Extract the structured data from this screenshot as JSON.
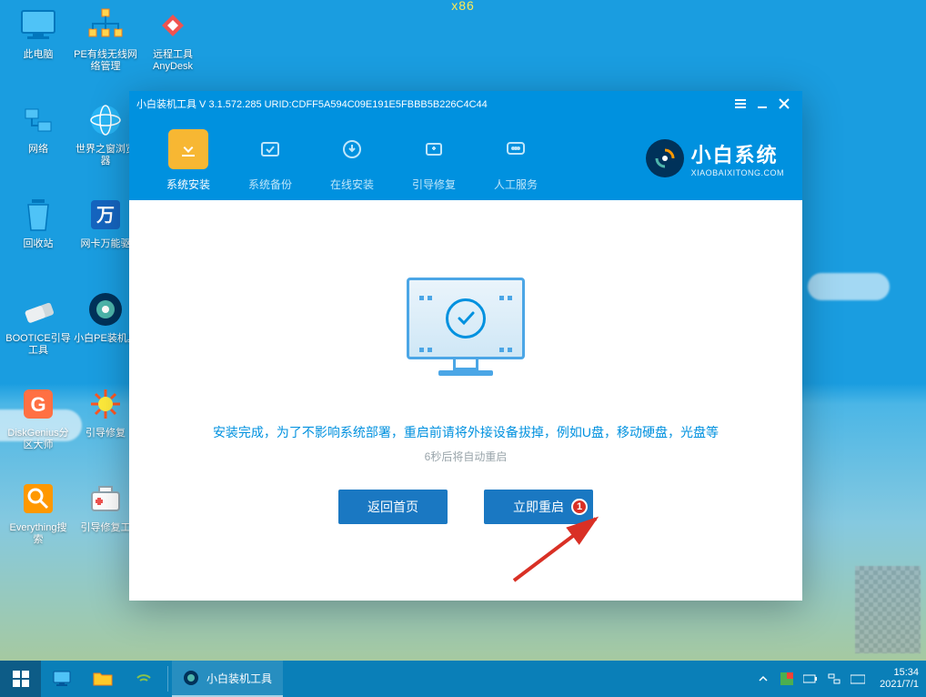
{
  "arch": "x86",
  "desktop_icons": [
    {
      "id": "this-pc",
      "label": "此电脑"
    },
    {
      "id": "pe-net",
      "label": "PE有线无线网络管理"
    },
    {
      "id": "anydesk",
      "label": "远程工具AnyDesk"
    },
    {
      "id": "network",
      "label": "网络"
    },
    {
      "id": "world-browser",
      "label": "世界之窗浏览器"
    },
    {
      "id": "placeholder-1",
      "label": ""
    },
    {
      "id": "recycle-bin",
      "label": "回收站"
    },
    {
      "id": "netcard-driver",
      "label": "网卡万能驱"
    },
    {
      "id": "placeholder-2",
      "label": ""
    },
    {
      "id": "bootice",
      "label": "BOOTICE引导工具"
    },
    {
      "id": "xiaobai-pe",
      "label": "小白PE装机具"
    },
    {
      "id": "placeholder-3",
      "label": ""
    },
    {
      "id": "diskgenius",
      "label": "DiskGenius分区大师"
    },
    {
      "id": "boot-repair",
      "label": "引导修复"
    },
    {
      "id": "placeholder-4",
      "label": ""
    },
    {
      "id": "everything",
      "label": "Everything搜索"
    },
    {
      "id": "boot-repair-tool",
      "label": "引导修复工"
    }
  ],
  "window": {
    "title": "小白装机工具 V 3.1.572.285 URID:CDFF5A594C09E191E5FBBB5B226C4C44",
    "tabs": [
      {
        "id": "install",
        "label": "系统安装",
        "active": true
      },
      {
        "id": "backup",
        "label": "系统备份",
        "active": false
      },
      {
        "id": "online",
        "label": "在线安装",
        "active": false
      },
      {
        "id": "bootfix",
        "label": "引导修复",
        "active": false
      },
      {
        "id": "support",
        "label": "人工服务",
        "active": false
      }
    ],
    "brand": {
      "title": "小白系统",
      "subtitle": "XIAOBAIXITONG.COM"
    },
    "message_main": "安装完成，为了不影响系统部署，重启前请将外接设备拔掉，例如U盘，移动硬盘，光盘等",
    "message_sub": "6秒后将自动重启",
    "buttons": {
      "home": "返回首页",
      "restart": "立即重启"
    },
    "callout_badge": "1"
  },
  "taskbar": {
    "app_label": "小白装机工具",
    "clock": {
      "time": "15:34",
      "date": "2021/7/1"
    }
  }
}
